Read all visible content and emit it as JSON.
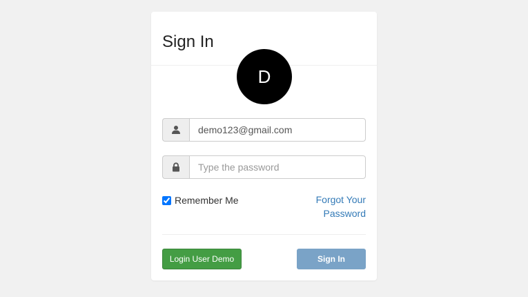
{
  "panel": {
    "title": "Sign In",
    "avatar_letter": "D",
    "avatar_color": "#000000"
  },
  "email": {
    "value": "demo123@gmail.com",
    "icon": "user-icon"
  },
  "password": {
    "value": "",
    "placeholder": "Type the password",
    "icon": "lock-icon"
  },
  "remember": {
    "label": "Remember Me",
    "checked": true
  },
  "forgot_link": "Forgot Your Password",
  "buttons": {
    "demo_label": "Login User Demo",
    "demo_color": "#449d44",
    "signin_label": "Sign In",
    "signin_color": "#7aa3c7"
  }
}
